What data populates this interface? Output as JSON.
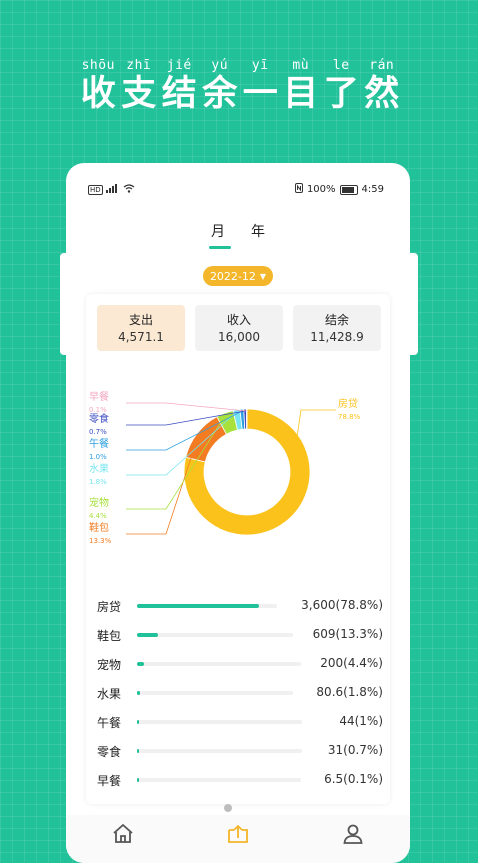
{
  "headline": {
    "pinyin": [
      "shōu",
      "zhī",
      "jié",
      "yú",
      "yī",
      "mù",
      "le",
      "rán"
    ],
    "chars": [
      "收",
      "支",
      "结",
      "余",
      "一",
      "目",
      "了",
      "然"
    ]
  },
  "status_bar": {
    "hd": "HD",
    "signal": "4G",
    "battery_text": "100%",
    "time": "4:59",
    "icons": [
      "signal-icon",
      "wifi-icon",
      "nfc-icon",
      "battery-icon"
    ]
  },
  "tabs": [
    {
      "label": "月",
      "active": true
    },
    {
      "label": "年",
      "active": false
    }
  ],
  "date_selector": {
    "value": "2022-12"
  },
  "summary": {
    "expense": {
      "label": "支出",
      "value": "4,571.1"
    },
    "income": {
      "label": "收入",
      "value": "16,000"
    },
    "balance": {
      "label": "结余",
      "value": "11,428.9"
    }
  },
  "chart_data": {
    "type": "pie",
    "donut": true,
    "categories": [
      "房贷",
      "鞋包",
      "宠物",
      "水果",
      "午餐",
      "零食",
      "早餐"
    ],
    "values": [
      3600,
      609,
      200,
      80.6,
      44,
      31,
      6.5
    ],
    "percent_labels": [
      "78.8%",
      "13.3%",
      "4.4%",
      "1.8%",
      "1.0%",
      "0.7%",
      "0.1%"
    ],
    "colors": [
      "#fbc21c",
      "#f37c22",
      "#a8e03c",
      "#79e5f0",
      "#2fa0df",
      "#3b4cc0",
      "#f4a7c1"
    ]
  },
  "ranking": [
    {
      "name": "房贷",
      "value": "3,600(78.8%)",
      "fraction": 0.788
    },
    {
      "name": "鞋包",
      "value": "609(13.3%)",
      "fraction": 0.133
    },
    {
      "name": "宠物",
      "value": "200(4.4%)",
      "fraction": 0.044
    },
    {
      "name": "水果",
      "value": "80.6(1.8%)",
      "fraction": 0.018
    },
    {
      "name": "午餐",
      "value": "44(1%)",
      "fraction": 0.01
    },
    {
      "name": "零食",
      "value": "31(0.7%)",
      "fraction": 0.007
    },
    {
      "name": "早餐",
      "value": "6.5(0.1%)",
      "fraction": 0.001
    }
  ],
  "bottom_nav": [
    {
      "icon": "home-icon",
      "active": false,
      "color": "#555555"
    },
    {
      "icon": "ledger-icon",
      "active": true,
      "color": "#f4b62a"
    },
    {
      "icon": "user-icon",
      "active": false,
      "color": "#555555"
    }
  ],
  "colors": {
    "accent": "#21c19a",
    "date_pill": "#f4b62a",
    "expense_box": "#fbe9d3"
  }
}
